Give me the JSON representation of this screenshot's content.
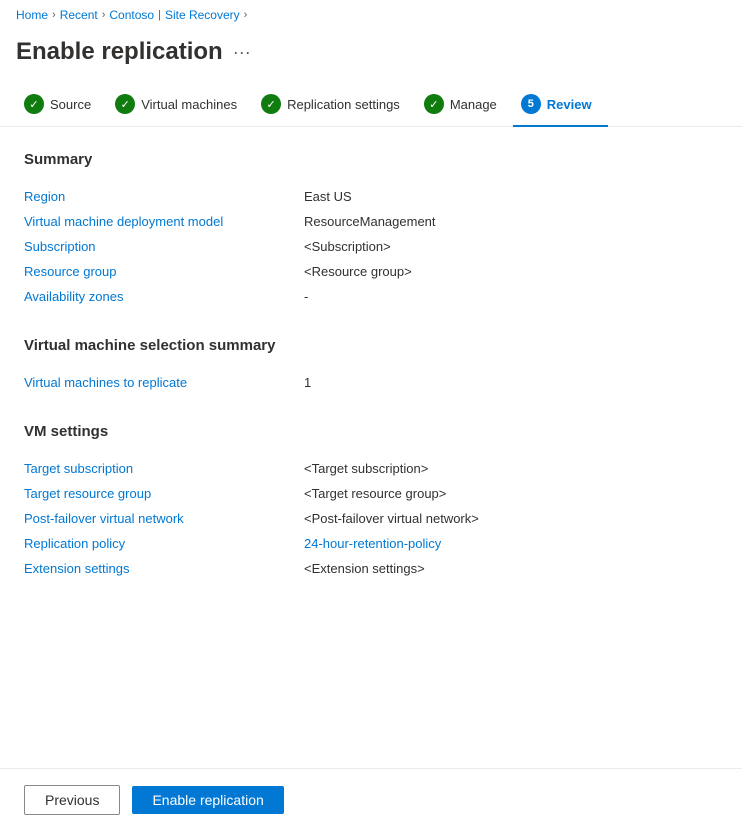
{
  "breadcrumb": {
    "items": [
      {
        "label": "Home",
        "link": true
      },
      {
        "label": "Recent",
        "link": true
      },
      {
        "label": "Contoso",
        "link": true
      },
      {
        "label": "Site Recovery",
        "link": true,
        "current": false
      }
    ],
    "separators": [
      ">",
      ">",
      ">",
      ">"
    ]
  },
  "page": {
    "title": "Enable replication",
    "ellipsis": "..."
  },
  "steps": [
    {
      "id": "source",
      "label": "Source",
      "status": "complete",
      "number": null
    },
    {
      "id": "virtual-machines",
      "label": "Virtual machines",
      "status": "complete",
      "number": null
    },
    {
      "id": "replication-settings",
      "label": "Replication settings",
      "status": "complete",
      "number": null
    },
    {
      "id": "manage",
      "label": "Manage",
      "status": "complete",
      "number": null
    },
    {
      "id": "review",
      "label": "Review",
      "status": "active",
      "number": "5"
    }
  ],
  "summary": {
    "title": "Summary",
    "rows": [
      {
        "label": "Region",
        "value": "East US",
        "is_link": false
      },
      {
        "label": "Virtual machine deployment model",
        "value": "ResourceManagement",
        "is_link": false
      },
      {
        "label": "Subscription",
        "value": "<Subscription>",
        "is_link": false
      },
      {
        "label": "Resource group",
        "value": "<Resource group>",
        "is_link": false
      },
      {
        "label": "Availability zones",
        "value": "-",
        "is_link": false
      }
    ]
  },
  "vm_selection": {
    "title": "Virtual machine selection summary",
    "rows": [
      {
        "label": "Virtual machines to replicate",
        "value": "1",
        "is_link": false
      }
    ]
  },
  "vm_settings": {
    "title": "VM settings",
    "rows": [
      {
        "label": "Target subscription",
        "value": "<Target subscription>",
        "is_link": false
      },
      {
        "label": "Target resource group",
        "value": "<Target resource group>",
        "is_link": false
      },
      {
        "label": "Post-failover virtual network",
        "value": "<Post-failover virtual network>",
        "is_link": false
      },
      {
        "label": "Replication policy",
        "value": "24-hour-retention-policy",
        "is_link": true
      },
      {
        "label": "Extension settings",
        "value": "<Extension settings>",
        "is_link": false
      }
    ]
  },
  "footer": {
    "previous_label": "Previous",
    "enable_label": "Enable replication"
  },
  "icons": {
    "check": "✓",
    "ellipsis": "···"
  }
}
